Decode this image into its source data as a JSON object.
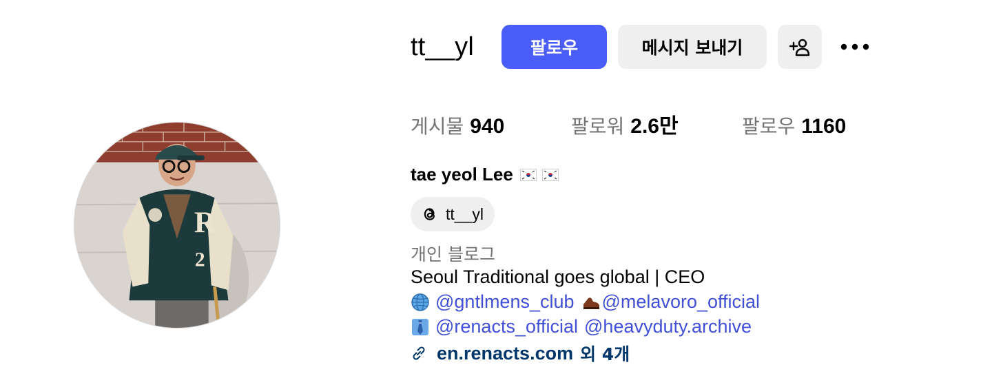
{
  "profile": {
    "username": "tt__yl",
    "full_name": "tae yeol Lee",
    "flag_emojis": [
      "kr-flag",
      "kr-flag"
    ]
  },
  "actions": {
    "follow_label": "팔로우",
    "message_label": "메시지 보내기",
    "add_user_icon": "add-user-icon",
    "more_icon": "more-options-icon"
  },
  "stats": {
    "posts_label": "게시물",
    "posts_value": "940",
    "followers_label": "팔로워",
    "followers_value": "2.6만",
    "following_label": "팔로우",
    "following_value": "1160"
  },
  "threads_badge": {
    "handle": "tt__yl",
    "icon": "threads-icon"
  },
  "bio": {
    "category": "개인 블로그",
    "line1": "Seoul Traditional goes global | CEO",
    "line2_emoji": "globe-icon",
    "line2_mention1": "@gntlmens_club",
    "line2_emoji2": "shoe-icon",
    "line2_mention2": "@melavoro_official",
    "line3_emoji": "necktie-icon",
    "line3_mention1": "@renacts_official",
    "line3_mention2": "@heavyduty.archive",
    "link_text": "en.renacts.com",
    "link_suffix": "외 4개"
  },
  "colors": {
    "primary_button": "#4a5df9",
    "secondary_button": "#efefef",
    "mention": "#4150d6",
    "link": "#00376b",
    "muted_text": "#737373"
  }
}
